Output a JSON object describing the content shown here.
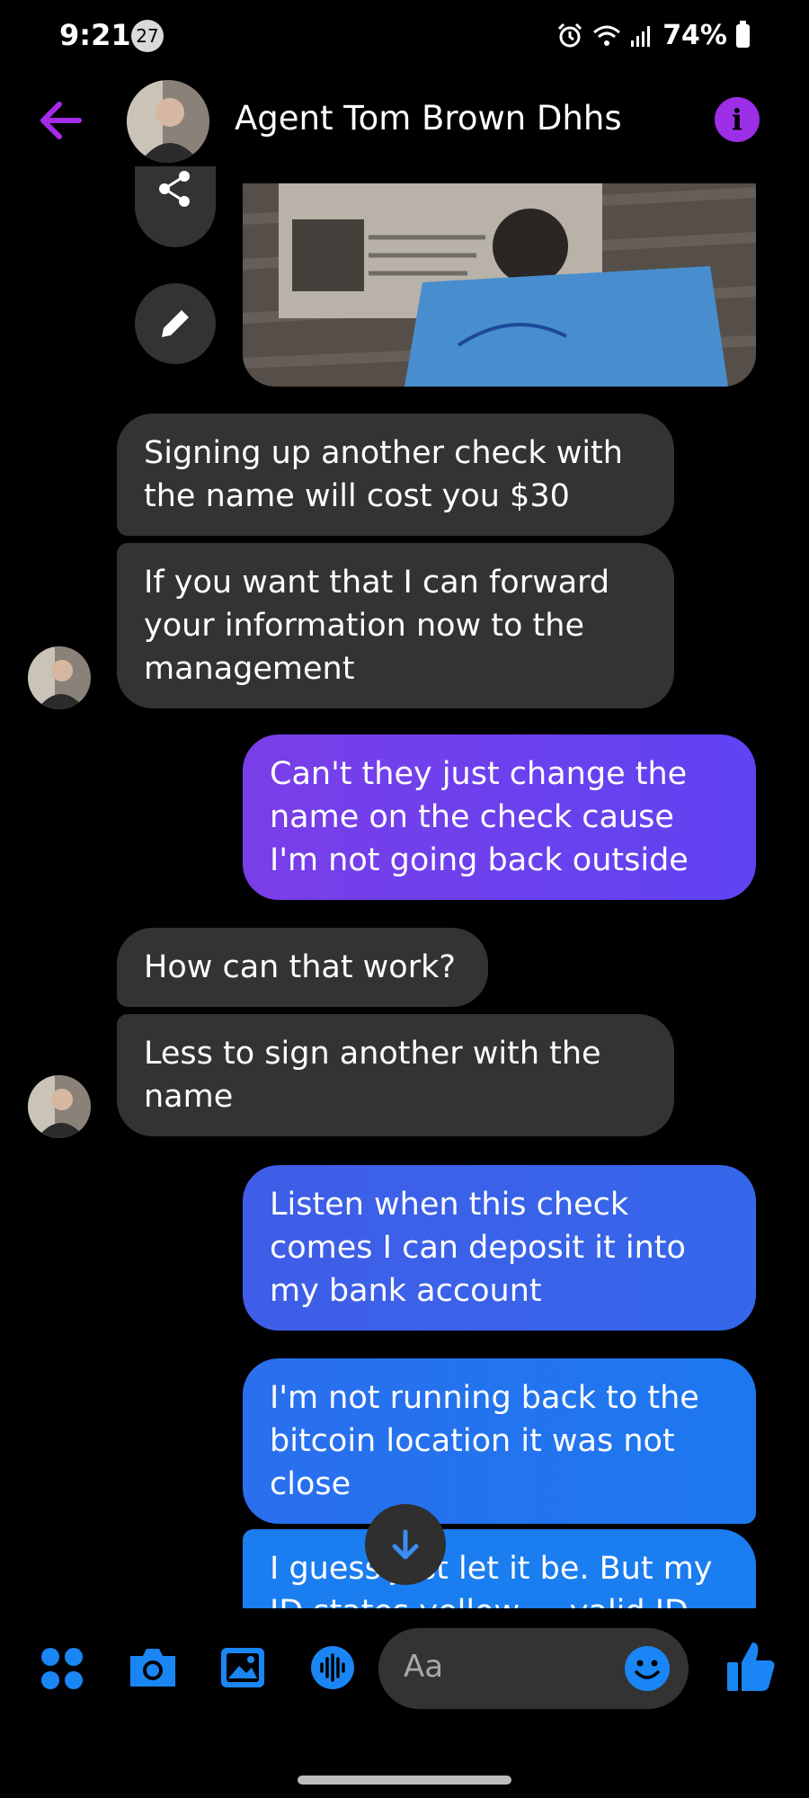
{
  "status_bar": {
    "time": "9:21",
    "notification_count": "27",
    "battery": "74%"
  },
  "header": {
    "contact_name": "Agent Tom Brown Dhhs",
    "info_label": "i"
  },
  "messages": [
    {
      "side": "received",
      "text": "Signing up another check with the name will cost you $30"
    },
    {
      "side": "received",
      "text": "If you want that I can forward your information now to the management"
    },
    {
      "side": "sent",
      "text": "Can't they just change the name on the check cause I'm not going back outside"
    },
    {
      "side": "received",
      "text": "How can that work?"
    },
    {
      "side": "received",
      "text": "Less to sign another with the name"
    },
    {
      "side": "sent",
      "text": "Listen when this check comes I can deposit it into my bank account"
    },
    {
      "side": "sent",
      "text": "I'm not running back to the bitcoin location it was not close"
    },
    {
      "side": "sent",
      "text": "I guess just let it be. But my ID states yellow ... valid ID"
    }
  ],
  "composer": {
    "placeholder": "Aa"
  },
  "colors": {
    "accent_purple": "#9d2ee8",
    "bubble_received": "#333333",
    "bubble_sent_purple": "#6a3ff0",
    "bubble_sent_indigo": "#3c63e8",
    "bubble_sent_blue": "#1d78ef",
    "icon_blue": "#1a86f5"
  },
  "icons": [
    "arrow-left-icon",
    "info-icon",
    "share-icon",
    "pencil-icon",
    "arrow-down-icon",
    "apps-icon",
    "camera-icon",
    "gallery-icon",
    "voice-icon",
    "emoji-icon",
    "thumbs-up-icon"
  ]
}
